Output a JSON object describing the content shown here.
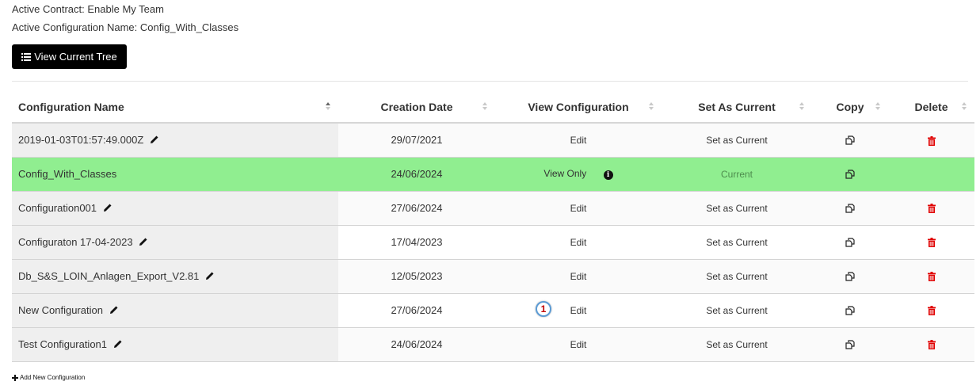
{
  "header": {
    "active_contract": "Active Contract: Enable My Team",
    "active_configuration": "Active Configuration Name: Config_With_Classes",
    "view_tree_label": "View Current Tree"
  },
  "table": {
    "columns": {
      "name": "Configuration Name",
      "date": "Creation Date",
      "view": "View Configuration",
      "set_current": "Set As Current",
      "copy": "Copy",
      "delete": "Delete"
    },
    "sorted_column": "Configuration Name",
    "sort_direction": "ascending",
    "rows": [
      {
        "name": "2019-01-03T01:57:49.000Z",
        "date": "29/07/2021",
        "view": "Edit",
        "set": "Set as Current",
        "current": false
      },
      {
        "name": "Config_With_Classes",
        "date": "24/06/2024",
        "view": "View Only",
        "set": "Current",
        "current": true
      },
      {
        "name": "Configuration001",
        "date": "27/06/2024",
        "view": "Edit",
        "set": "Set as Current",
        "current": false
      },
      {
        "name": "Configuraton 17-04-2023",
        "date": "17/04/2023",
        "view": "Edit",
        "set": "Set as Current",
        "current": false
      },
      {
        "name": "Db_S&S_LOIN_Anlagen_Export_V2.81",
        "date": "12/05/2023",
        "view": "Edit",
        "set": "Set as Current",
        "current": false
      },
      {
        "name": "New Configuration",
        "date": "27/06/2024",
        "view": "Edit",
        "set": "Set as Current",
        "current": false
      },
      {
        "name": "Test Configuration1",
        "date": "24/06/2024",
        "view": "Edit",
        "set": "Set as Current",
        "current": false
      }
    ]
  },
  "annotation": {
    "badge_number": "1"
  },
  "footer": {
    "add_new_label": "Add New Configuration"
  },
  "colors": {
    "current_row": "#90ee90",
    "delete_icon": "#e00000",
    "badge_border": "#5b9bd5",
    "badge_text": "#c00000"
  },
  "icons": {
    "view_tree": "list-icon",
    "name_edit": "pencil-icon",
    "view_info": "info-icon",
    "copy": "copy-icon",
    "delete": "trash-icon",
    "add": "plus-icon",
    "sort": "sort-arrows-icon"
  }
}
